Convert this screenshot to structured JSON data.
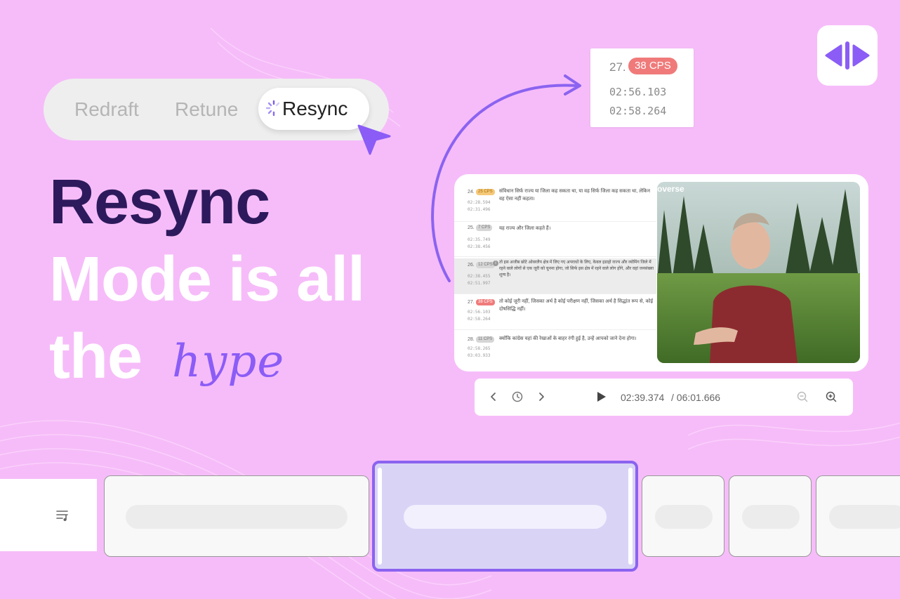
{
  "modes": {
    "redraft": "Redraft",
    "retune": "Retune",
    "resync": "Resync"
  },
  "headline": {
    "line1": "Resync",
    "line2": "Mode is all",
    "line3": "the",
    "hype": "hype"
  },
  "cps_card": {
    "number": "27.",
    "badge": "38 CPS",
    "start": "02:56.103",
    "end": "02:58.264"
  },
  "subtitles": [
    {
      "num": "24.",
      "cps": "25 CPS",
      "text": "संविधान सिर्फ राज्य या जिला कह सकता था, या वह सिर्फ जिला कह सकता था, लेकिन वह ऐसा नहीं कहता।",
      "start": "02:28.594",
      "end": "02:31.496"
    },
    {
      "num": "25.",
      "cps": "7 CPS",
      "text": "यह राज्य और जिला कहते हैं।",
      "start": "02:35.749",
      "end": "02:38.456"
    },
    {
      "num": "26.",
      "cps": "12 CPS",
      "text": "तो इस अजीब छोटे ओवरलैप क्षेत्र में लिए गए अपराधों के लिए, केवल इडाहो राज्य और व्योमिंग जिले में रहने वाले लोगों से एक जूरी को चुनना होगा, जो सिर्फ इस क्षेत्र में रहने वाले लोग होंगे, और वहां जनसंख्या शून्य है।",
      "start": "02:38.455",
      "end": "02:51.997"
    },
    {
      "num": "27.",
      "cps": "38 CPS",
      "text": "तो कोई जूरी नहीं, जिसका अर्थ है कोई परीक्षण नहीं, जिसका अर्थ है सिद्धांत रूप से, कोई दोषसिद्धि नहीं।",
      "start": "02:56.103",
      "end": "02:58.264"
    },
    {
      "num": "28.",
      "cps": "11 CPS",
      "text": "क्योंकि कांग्रेस यहां की रेखाओं के बाहर रंगी हुई है, उन्हें आपको जाने देना होगा।",
      "start": "02:58.265",
      "end": "03:03.933"
    }
  ],
  "video": {
    "watermark": "overse"
  },
  "player": {
    "current": "02:39.374",
    "total": "/ 06:01.666"
  },
  "icons": {
    "spinner": "spinner-icon",
    "cursor": "cursor-arrow-icon",
    "logo": "resync-logo-icon",
    "prev": "chevron-left-icon",
    "history": "clock-icon",
    "next": "chevron-right-icon",
    "play": "play-icon",
    "zoom_out": "zoom-out-icon",
    "zoom_in": "zoom-in-icon",
    "list": "playlist-icon"
  },
  "colors": {
    "background": "#f6bcf9",
    "accent": "#8b63f0",
    "headline_dark": "#2d1a5c",
    "cps_high": "#f07a7a",
    "cps_mid": "#f5c97a",
    "cps_low": "#c9c9c9"
  }
}
